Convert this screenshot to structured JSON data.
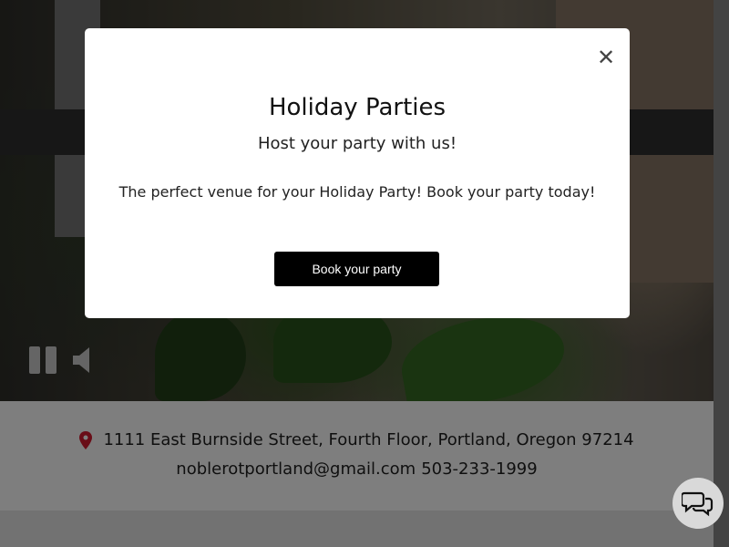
{
  "video": {
    "pause_icon": "pause-icon",
    "mute_icon": "speaker-mute-icon"
  },
  "contact": {
    "address": "1111 East Burnside Street, Fourth Floor, Portland, Oregon 97214",
    "email": "noblerotportland@gmail.com",
    "phone": "503-233-1999",
    "pin_icon": "map-pin-icon",
    "pin_color": "#c0182b"
  },
  "chat": {
    "icon": "chat-bubbles-icon"
  },
  "modal": {
    "close_label": "✕",
    "title": "Holiday Parties",
    "subtitle": "Host your party with us!",
    "body": "The perfect venue for your Holiday Party! Book your party today!",
    "button_label": "Book your party"
  }
}
